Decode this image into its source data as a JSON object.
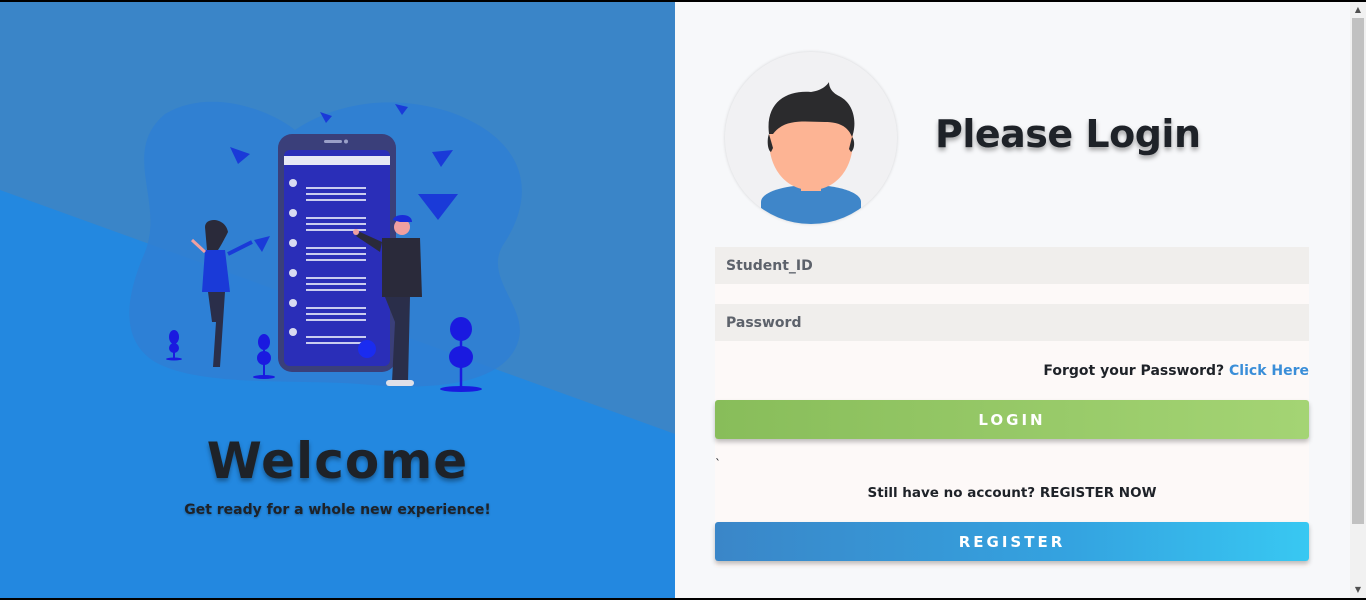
{
  "welcome": {
    "title": "Welcome",
    "tagline": "Get ready for a whole new experience!"
  },
  "login": {
    "title": "Please Login",
    "student_id_placeholder": "Student_ID",
    "password_placeholder": "Password",
    "forgot_text": "Forgot your Password?",
    "forgot_link": "Click Here",
    "login_button": "LOGIN",
    "stray_mark": "`",
    "no_account_text": "Still have no account? REGISTER NOW",
    "register_button": "REGISTER"
  },
  "icons": {
    "avatar": "user-avatar-icon",
    "illustration": "phone-people-illustration",
    "scroll_up": "triangle-up-icon",
    "scroll_down": "triangle-down-icon"
  },
  "colors": {
    "left_bg": "#2388e0",
    "left_bg_dark": "#3a85c8",
    "title_text": "#1e2228",
    "link": "#3a8ed8",
    "login_gradient_start": "#88bd5a",
    "login_gradient_end": "#a4d474",
    "register_gradient_start": "#3a86c8",
    "register_gradient_end": "#38c8f2"
  }
}
